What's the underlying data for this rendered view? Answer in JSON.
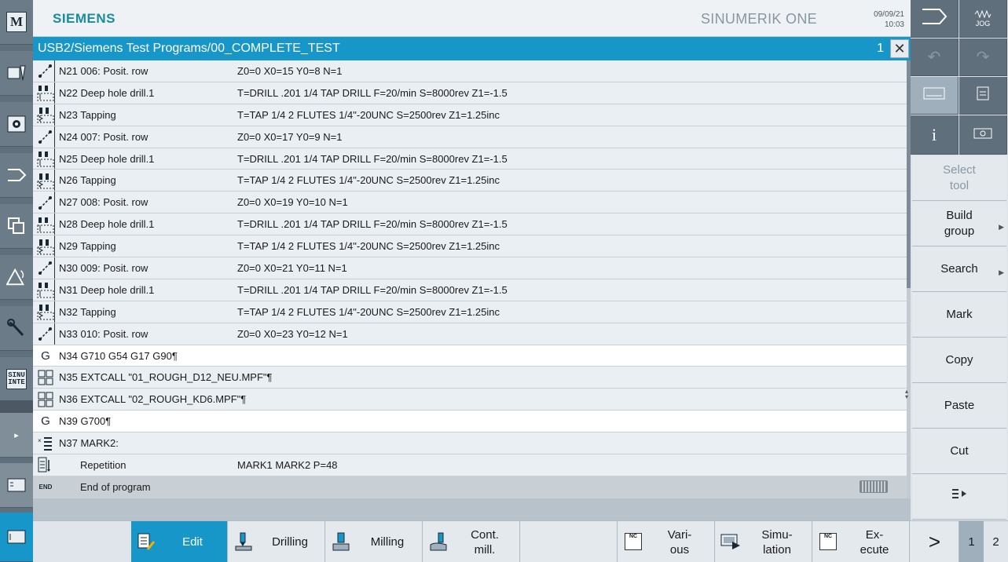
{
  "header": {
    "brand": "SIEMENS",
    "product": "SINUMERIK ONE",
    "date": "09/09/21",
    "time": "10:03"
  },
  "titlebar": {
    "path": "USB2/Siemens Test Programs/00_COMPLETE_TEST",
    "channel": "1"
  },
  "left_bar": {
    "machine_label": "M",
    "sinumerik_label_1": "SINU",
    "sinumerik_label_2": "INTE"
  },
  "program_rows": [
    {
      "icon": "positions-icon",
      "name": "N21 006: Posit. row",
      "params": "Z0=0 X0=15 Y0=8 N=1"
    },
    {
      "icon": "drill-icon",
      "name": "N22 Deep hole drill.1",
      "params": "T=DRILL .201 1/4 TAP DRILL F=20/min S=8000rev Z1=-1.5"
    },
    {
      "icon": "tap-icon",
      "name": "N23 Tapping",
      "params": "T=TAP 1/4 2 FLUTES 1/4\"-20UNC S=2500rev Z1=1.25inc"
    },
    {
      "icon": "positions-icon",
      "name": "N24 007: Posit. row",
      "params": "Z0=0 X0=17 Y0=9 N=1"
    },
    {
      "icon": "drill-icon",
      "name": "N25 Deep hole drill.1",
      "params": "T=DRILL .201 1/4 TAP DRILL F=20/min S=8000rev Z1=-1.5"
    },
    {
      "icon": "tap-icon",
      "name": "N26 Tapping",
      "params": "T=TAP 1/4 2 FLUTES 1/4\"-20UNC S=2500rev Z1=1.25inc"
    },
    {
      "icon": "positions-icon",
      "name": "N27 008: Posit. row",
      "params": "Z0=0 X0=19 Y0=10 N=1"
    },
    {
      "icon": "drill-icon",
      "name": "N28 Deep hole drill.1",
      "params": "T=DRILL .201 1/4 TAP DRILL F=20/min S=8000rev Z1=-1.5"
    },
    {
      "icon": "tap-icon",
      "name": "N29 Tapping",
      "params": "T=TAP 1/4 2 FLUTES 1/4\"-20UNC S=2500rev Z1=1.25inc"
    },
    {
      "icon": "positions-icon",
      "name": "N30 009: Posit. row",
      "params": "Z0=0 X0=21 Y0=11 N=1"
    },
    {
      "icon": "drill-icon",
      "name": "N31 Deep hole drill.1",
      "params": "T=DRILL .201 1/4 TAP DRILL F=20/min S=8000rev Z1=-1.5"
    },
    {
      "icon": "tap-icon",
      "name": "N32 Tapping",
      "params": "T=TAP 1/4 2 FLUTES 1/4\"-20UNC S=2500rev Z1=1.25inc"
    },
    {
      "icon": "positions-icon",
      "name": "N33 010: Posit. row",
      "params": "Z0=0 X0=23 Y0=12 N=1"
    },
    {
      "icon": "gcode-icon",
      "name": "N34 G710 G54 G17 G90¶",
      "params": ""
    },
    {
      "icon": "subprogram-icon",
      "name": "N35 EXTCALL \"01_ROUGH_D12_NEU.MPF\"¶",
      "params": ""
    },
    {
      "icon": "subprogram-icon",
      "name": "N36 EXTCALL \"02_ROUGH_KD6.MPF\"¶",
      "params": ""
    },
    {
      "icon": "gcode-icon",
      "name": "N39 G700¶",
      "params": ""
    },
    {
      "icon": "mark-icon",
      "name": "N37 MARK2:",
      "params": ""
    },
    {
      "icon": "repeat-icon",
      "name": "Repetition",
      "params": "MARK1 MARK2 P=48"
    },
    {
      "icon": "end-icon",
      "name": "End of program",
      "params": ""
    }
  ],
  "end_icon_text": "END",
  "gcode_icon_text": "G",
  "right_top": {
    "jog_label": "JOG"
  },
  "right_softkeys": [
    {
      "label_1": "Select",
      "label_2": "tool"
    },
    {
      "label_1": "Build",
      "label_2": "group"
    },
    {
      "label_1": "Search",
      "label_2": ""
    },
    {
      "label_1": "Mark",
      "label_2": ""
    },
    {
      "label_1": "Copy",
      "label_2": ""
    },
    {
      "label_1": "Paste",
      "label_2": ""
    },
    {
      "label_1": "Cut",
      "label_2": ""
    }
  ],
  "bottom_softkeys": {
    "edit": "Edit",
    "drilling": "Drilling",
    "milling": "Milling",
    "cont_mill_1": "Cont.",
    "cont_mill_2": "mill.",
    "various_1": "Vari-",
    "various_2": "ous",
    "simulation_1": "Simu-",
    "simulation_2": "lation",
    "execute_1": "Ex-",
    "execute_2": "ecute",
    "nc_label": "NC",
    "page_1": "1",
    "page_2": "2"
  },
  "colors": {
    "accent": "#1696c9",
    "brand": "#1a8c9e",
    "sidebar": "#5f6f7b"
  }
}
